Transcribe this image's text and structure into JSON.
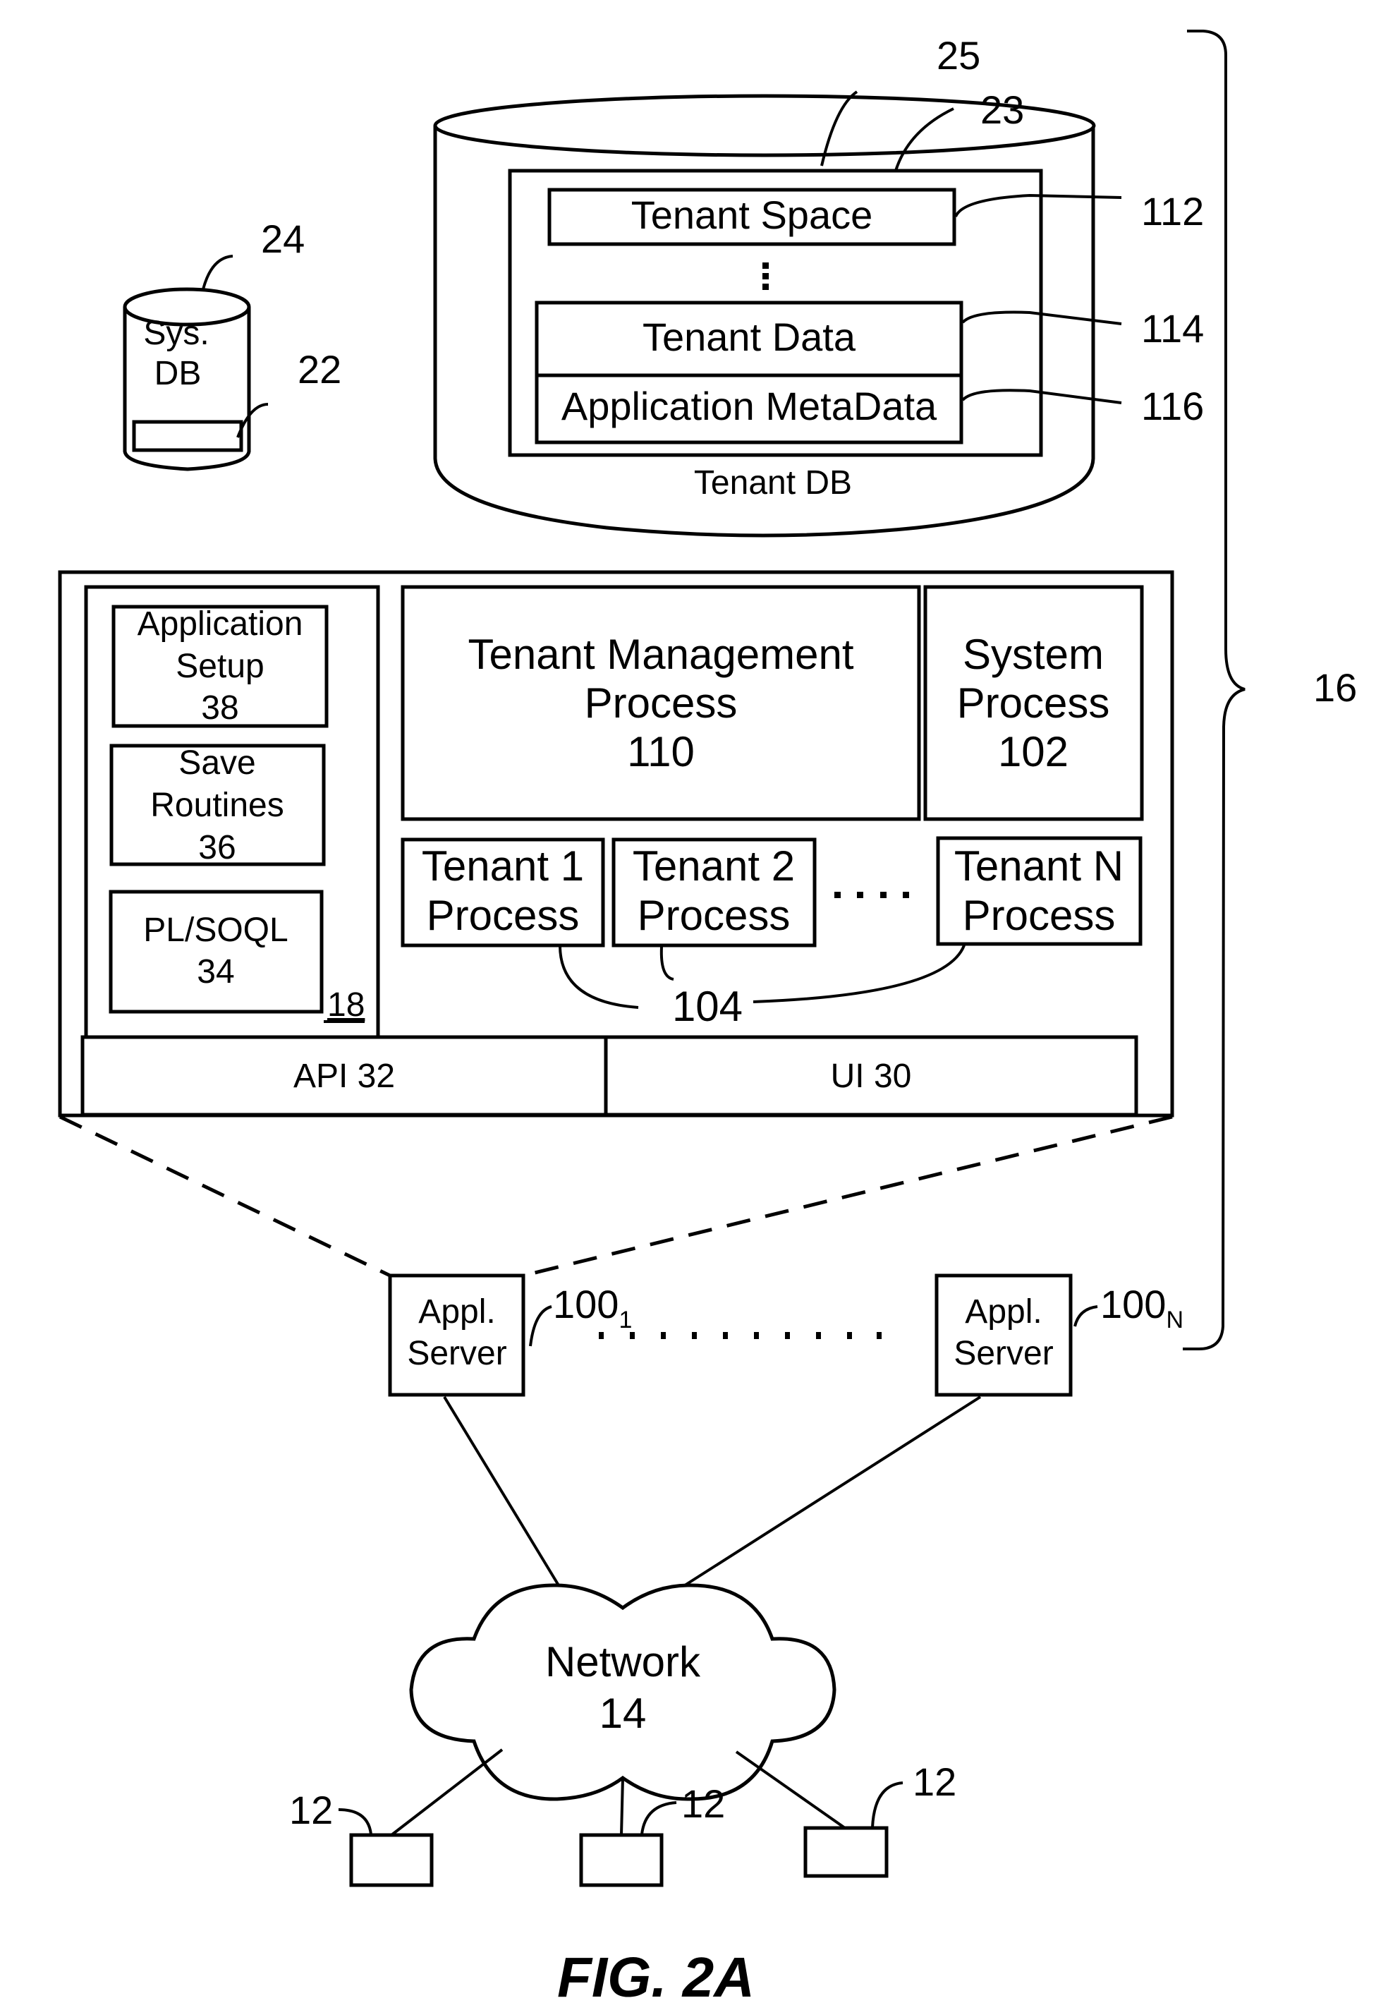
{
  "figure": {
    "caption": "FIG. 2A",
    "system_ref": "16"
  },
  "tenant_db": {
    "label": "Tenant DB",
    "ref": "25",
    "container_ref": "23",
    "tenant_space": {
      "label": "Tenant Space",
      "ref": "112"
    },
    "tenant_data": {
      "label": "Tenant Data",
      "ref": "114"
    },
    "app_metadata": {
      "label": "Application MetaData",
      "ref": "116"
    },
    "ellipsis": "⋮"
  },
  "sys_db": {
    "line1": "Sys.",
    "line2": "DB",
    "ref": "24",
    "inner_ref": "22"
  },
  "app_server_detail": {
    "left_panel_ref": "18",
    "app_setup": {
      "line1": "Application",
      "line2": "Setup",
      "ref": "38"
    },
    "save_routines": {
      "line1": "Save",
      "line2": "Routines",
      "ref": "36"
    },
    "plsoql": {
      "line1": "PL/SOQL",
      "ref": "34"
    },
    "tenant_mgmt": {
      "line1": "Tenant Management",
      "line2": "Process",
      "ref": "110"
    },
    "system_process": {
      "line1": "System",
      "line2": "Process",
      "ref": "102"
    },
    "tenant_processes": [
      {
        "line1": "Tenant 1",
        "line2": "Process"
      },
      {
        "line1": "Tenant 2",
        "line2": "Process"
      },
      {
        "line1": "Tenant N",
        "line2": "Process"
      }
    ],
    "tenant_processes_ref": "104",
    "api": "API 32",
    "ui": "UI 30"
  },
  "app_servers": [
    {
      "line1": "Appl.",
      "line2": "Server",
      "ref": "100",
      "sub": "1"
    },
    {
      "line1": "Appl.",
      "line2": "Server",
      "ref": "100",
      "sub": "N"
    }
  ],
  "network": {
    "line1": "Network",
    "ref": "14"
  },
  "clients": [
    {
      "ref": "12"
    },
    {
      "ref": "12"
    },
    {
      "ref": "12"
    }
  ]
}
